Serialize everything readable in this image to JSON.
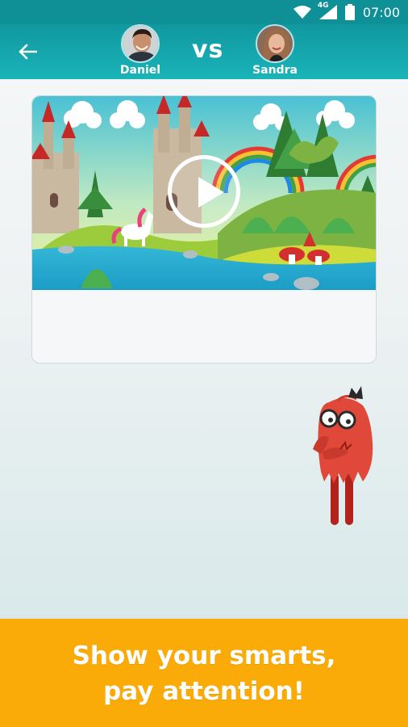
{
  "status_bar": {
    "time": "07:00",
    "network": "4G",
    "icons": [
      "wifi-icon",
      "cellular-signal-icon",
      "battery-icon"
    ]
  },
  "header": {
    "back_icon": "arrow-left-icon",
    "vs_label": "vs",
    "player1": {
      "name": "Daniel"
    },
    "player2": {
      "name": "Sandra"
    }
  },
  "video": {
    "play_icon": "play-icon"
  },
  "banner": {
    "line1": "Show your smarts,",
    "line2": "pay attention!"
  },
  "colors": {
    "header_bg": "#10989f",
    "banner_bg": "#fbab07",
    "accent_red": "#d9472b"
  }
}
